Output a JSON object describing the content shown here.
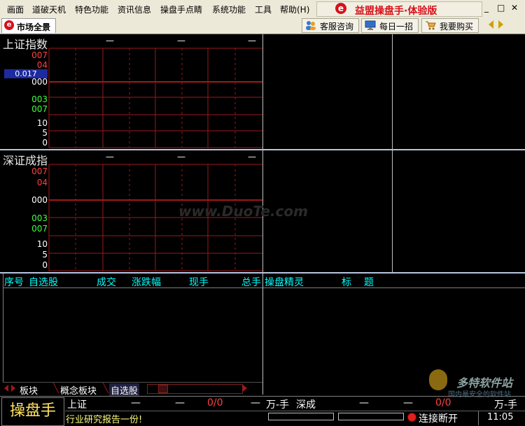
{
  "menubar": {
    "items": [
      "画面",
      "道破天机",
      "特色功能",
      "资讯信息",
      "操盘手点睛",
      "系统功能",
      "工具",
      "帮助(H)"
    ],
    "brand_title": "益盟操盘手·体验版",
    "brand_logo": "e",
    "window_controls": {
      "minimize": "_",
      "maximize": "□",
      "close": "✕"
    }
  },
  "toolbar": {
    "tab_label": "市场全景",
    "tab_logo": "e",
    "buttons": [
      {
        "label": "客服咨询",
        "icon": "people-icon"
      },
      {
        "label": "每日一招",
        "icon": "monitor-icon"
      },
      {
        "label": "我要购买",
        "icon": "cart-icon"
      }
    ],
    "nav_prev": "◀",
    "nav_next": "▶"
  },
  "shanghai": {
    "title": "上证指数",
    "dashes": [
      "—",
      "—",
      "—"
    ],
    "y_labels": [
      "007",
      "04",
      "000",
      "003",
      "007",
      "10",
      "5",
      "0"
    ],
    "marker_value": "0.017"
  },
  "shenzhen": {
    "title": "深证成指",
    "dashes": [
      "—",
      "—",
      "—"
    ],
    "y_labels": [
      "007",
      "04",
      "000",
      "003",
      "007",
      "10",
      "5",
      "0"
    ]
  },
  "watermark": "www.DuoTe.com",
  "watchlist": {
    "columns": [
      "序号",
      "自选股",
      "成交",
      "涨跌幅",
      "现手",
      "总手"
    ],
    "tabs": [
      "板块",
      "概念板块",
      "自选股"
    ],
    "active_tab": "自选股"
  },
  "genie": {
    "columns": [
      "操盘精灵",
      "标",
      "题"
    ]
  },
  "status": {
    "logo_text": "操盘手",
    "sh_label": "上证",
    "sh_dash1": "—",
    "sh_dash2": "—",
    "sh_ratio": "0/0",
    "sh_dash3": "—",
    "unit": "万-手",
    "sz_label": "深成",
    "sz_dash1": "—",
    "sz_dash2": "—",
    "sz_ratio": "0/0",
    "sz_unit": "万-手",
    "ticker": "行业研究报告一份!",
    "connection": "连接断开",
    "time": "11:05",
    "site_mark": "多特软件站",
    "site_sub": "国内最安全的软件站"
  },
  "colors": {
    "grid_red": "#a01818",
    "accent_red": "#d6111a",
    "cyan": "#00ffff",
    "background": "#000000"
  }
}
